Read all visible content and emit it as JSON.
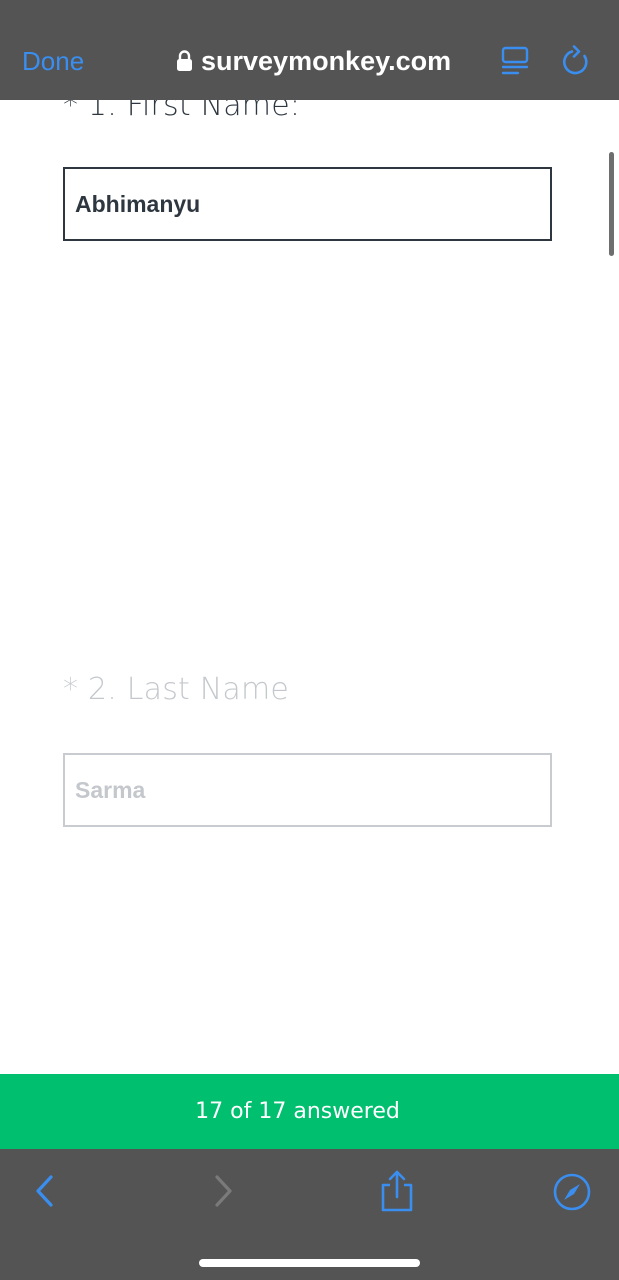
{
  "browser": {
    "done_label": "Done",
    "url": "surveymonkey.com",
    "icons": {
      "lock": "lock-icon",
      "reader": "reader-mode-icon",
      "reload": "reload-icon",
      "back": "chevron-left-icon",
      "forward": "chevron-right-icon",
      "share": "share-icon",
      "safari": "compass-icon"
    },
    "colors": {
      "bar_background": "#545454",
      "accent": "#3a8ef0"
    }
  },
  "survey": {
    "questions": [
      {
        "label": "* 1. First Name:",
        "value": "Abhimanyu"
      },
      {
        "label": "* 2. Last Name",
        "value": "Sarma"
      }
    ],
    "progress": {
      "text": "17 of 17 answered",
      "answered": 17,
      "total": 17,
      "color": "#00bf6f"
    }
  }
}
